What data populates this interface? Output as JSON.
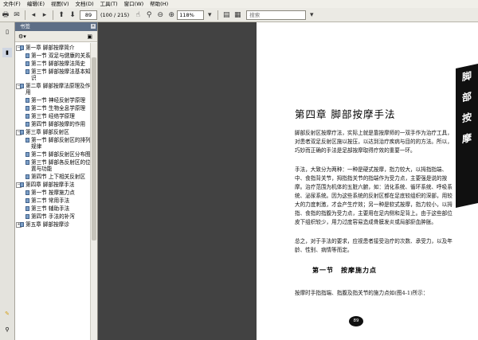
{
  "menubar": {
    "items": [
      "文件(F)",
      "编辑(E)",
      "视图(V)",
      "文档(D)",
      "工具(T)",
      "窗口(W)",
      "帮助(H)"
    ]
  },
  "toolbar": {
    "page_current": "89",
    "page_total": "(100 / 215)",
    "zoom": "118%",
    "search_placeholder": "搜索"
  },
  "panel": {
    "title": "书签",
    "close": "×"
  },
  "bookmarks": [
    {
      "label": "第一章 脚部按摩简介",
      "level": 0,
      "toggle": "−"
    },
    {
      "label": "第一节 双足与健康的关系",
      "level": 1
    },
    {
      "label": "第二节 脚部按摩法简史",
      "level": 1
    },
    {
      "label": "第三节 脚部按摩法基本知识",
      "level": 1
    },
    {
      "label": "第二章 脚部按摩法原理及作用",
      "level": 0,
      "toggle": "−"
    },
    {
      "label": "第一节 神经反射学原理",
      "level": 1
    },
    {
      "label": "第二节 生物全息学原理",
      "level": 1
    },
    {
      "label": "第三节 经络学原理",
      "level": 1
    },
    {
      "label": "第四节 脚部按摩的作用",
      "level": 1
    },
    {
      "label": "第三章 脚部反射区",
      "level": 0,
      "toggle": "−"
    },
    {
      "label": "第一节 脚部反射区的排列规律",
      "level": 1
    },
    {
      "label": "第二节 脚部反射区分布图",
      "level": 1
    },
    {
      "label": "第三节 脚部各反射区的位置与功能",
      "level": 1
    },
    {
      "label": "第四节 上下相关反射区",
      "level": 1
    },
    {
      "label": "第四章 脚部按摩手法",
      "level": 0,
      "toggle": "−"
    },
    {
      "label": "第一节 按摩施力点",
      "level": 1
    },
    {
      "label": "第二节 常用手法",
      "level": 1
    },
    {
      "label": "第三节 辅助手法",
      "level": 1
    },
    {
      "label": "第四节 手法的补泻",
      "level": 1
    },
    {
      "label": "第五章 脚部按摩诊",
      "level": 0,
      "toggle": "+"
    }
  ],
  "document": {
    "chapter_title": "第四章 脚部按摩手法",
    "side_tab": [
      "脚",
      "部",
      "按",
      "摩"
    ],
    "para1": "脚部反射区按摩疗法，实际上就是靠按摩师的一双手作为治疗工具，对患者双足反射区施以按压，以达到治疗疾病与目的的方法。所以，巧妙而正确的手法是足部按摩取得疗效的重要一环。",
    "para2": "手法，大致分为两种：一种是硬式按摩，指力较大，以拇指指端、中、食指背关节，拇指指关节的指端作为受力点，主要强是说的按摩。治疗范围为机体的五脏六腑，如：消化系统、循环系统、呼吸系统、泌尿系统。因为这些系统的反射区都在足底较组织的深部，用较大的力度刺激，才会产生疗效；另一种是软式按摩，指力较小，以拇指、食指的指腹为受力点，主要用在足内侧和足背上。由于这些部位皮下组织较少，用力过度容易造成骨膜发炎或局部瘀血肿胀。",
    "para3": "总之，对于手法的要求，应视患者接受治疗的次数、承受力，以及年龄、性别、病情等而定。",
    "section_title": "第一节　按摩施力点",
    "para4": "按摩时手指指端、指腹及指关节的施力点如(图4-1)所示：",
    "page_number": "89"
  }
}
